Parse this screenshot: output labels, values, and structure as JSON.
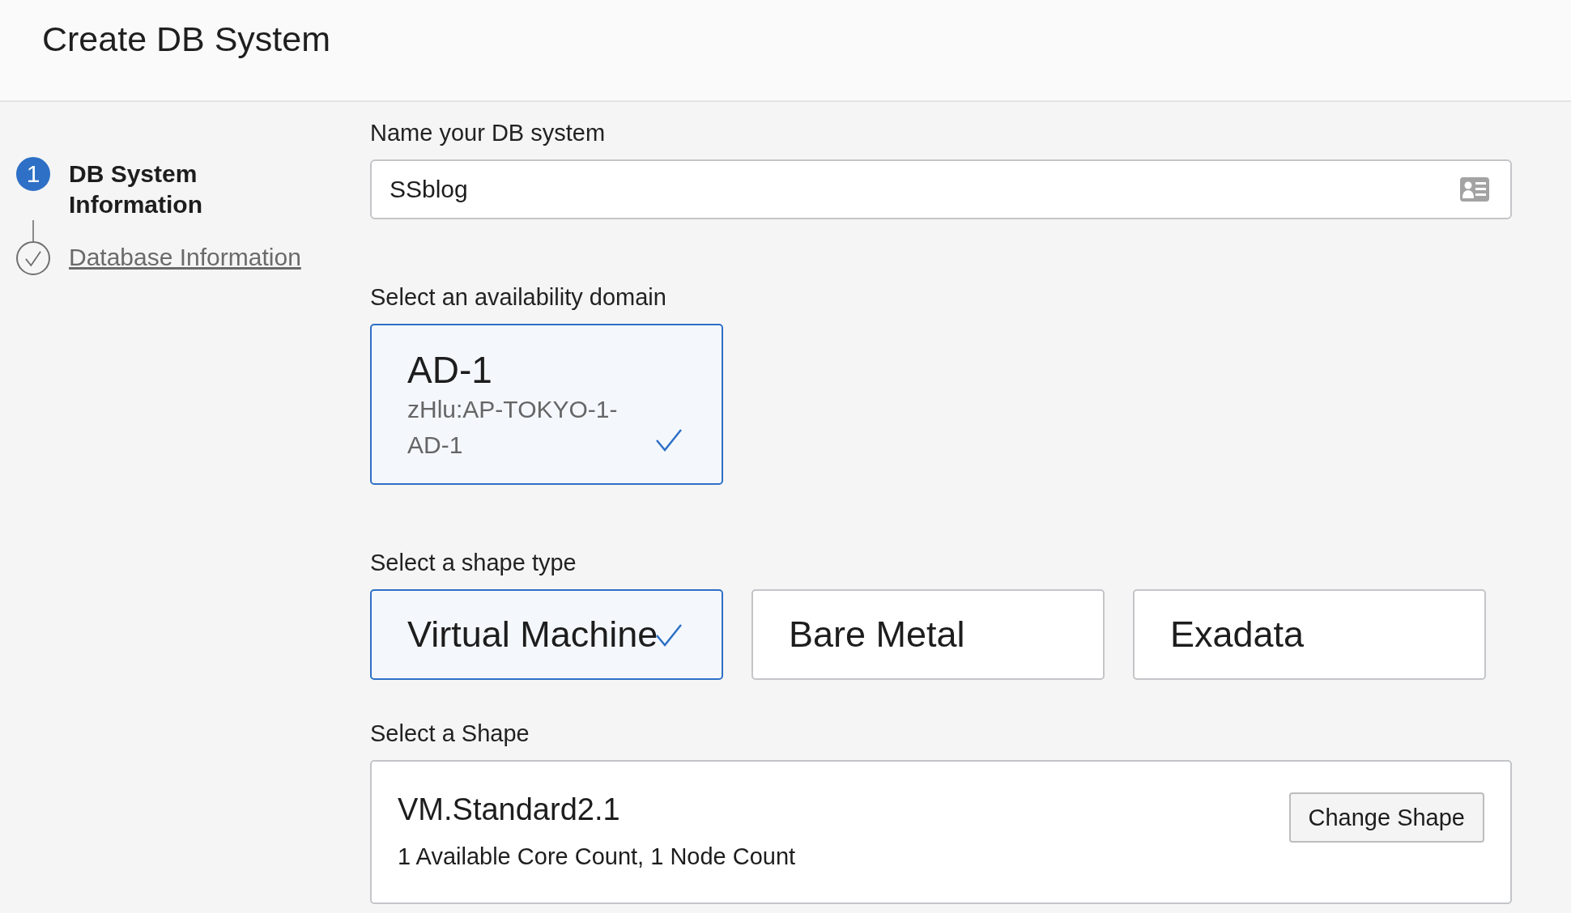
{
  "header": {
    "title": "Create DB System"
  },
  "steps": [
    {
      "kind": "number",
      "number": "1",
      "label": "DB System Information",
      "selected": true
    },
    {
      "kind": "check",
      "label": "Database Information",
      "selected": false
    }
  ],
  "name_field": {
    "label": "Name your DB system",
    "value": "SSblog"
  },
  "availability": {
    "label": "Select an availability domain",
    "domains": [
      {
        "name": "AD-1",
        "detail": "zHlu:AP-TOKYO-1-AD-1",
        "selected": true
      }
    ]
  },
  "shape_type": {
    "label": "Select a shape type",
    "options": [
      {
        "label": "Virtual Machine",
        "selected": true
      },
      {
        "label": "Bare Metal",
        "selected": false
      },
      {
        "label": "Exadata",
        "selected": false
      }
    ]
  },
  "shape": {
    "label": "Select a Shape",
    "name": "VM.Standard2.1",
    "detail": "1 Available Core Count, 1 Node Count",
    "button": "Change Shape"
  }
}
